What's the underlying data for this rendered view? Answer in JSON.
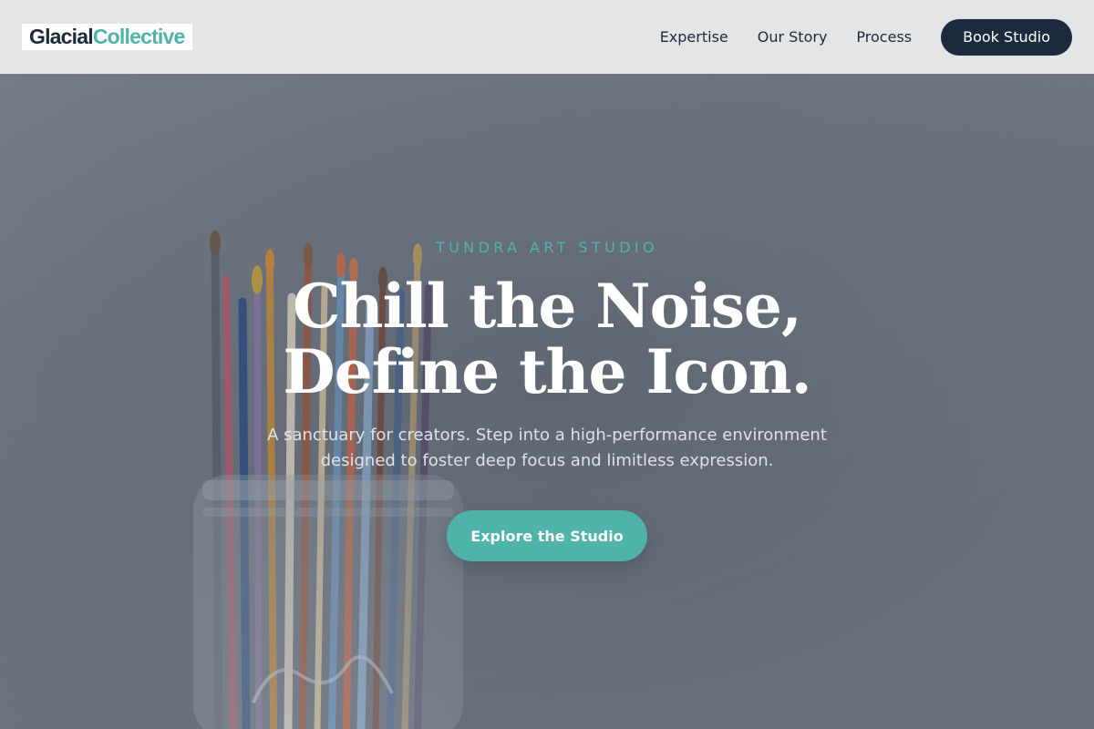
{
  "header": {
    "logo": {
      "part1": "Glacial",
      "part2": "Collective"
    },
    "nav": [
      {
        "label": "Expertise"
      },
      {
        "label": "Our Story"
      },
      {
        "label": "Process"
      }
    ],
    "cta_label": "Book Studio"
  },
  "hero": {
    "eyebrow": "TUNDRA ART STUDIO",
    "headline_line1": "Chill the Noise,",
    "headline_line2": "Define the Icon.",
    "subtext_line1": "A sanctuary for creators. Step into a high-performance environment",
    "subtext_line2": "designed to foster deep focus and limitless expression.",
    "button_label": "Explore the Studio",
    "background_image": "paintbrushes-in-glass-jar"
  },
  "colors": {
    "accent": "#4fb3a9",
    "dark": "#1c2a3e",
    "header_bg": "#e4e5e7",
    "hero_bg": "#6e7580"
  }
}
